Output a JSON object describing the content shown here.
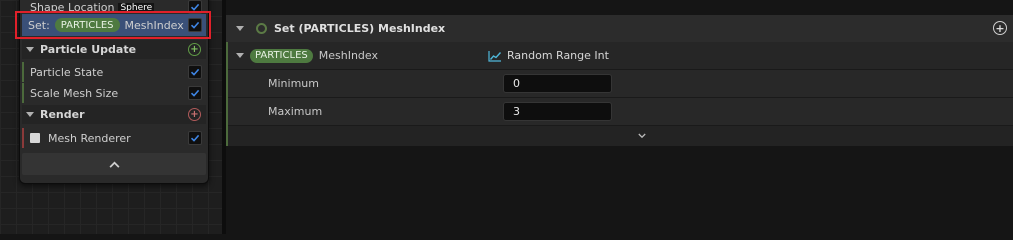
{
  "left_node": {
    "shape_location": {
      "label": "Shape Location",
      "value": "Sphere"
    },
    "set_row": {
      "prefix": "Set:",
      "pill": "PARTICLES",
      "label": "MeshIndex"
    },
    "particle_update": {
      "title": "Particle Update",
      "items": [
        "Particle State",
        "Scale Mesh Size"
      ]
    },
    "render": {
      "title": "Render",
      "items": [
        "Mesh Renderer"
      ]
    },
    "collapse_glyph": "^"
  },
  "panel": {
    "title": "Set (PARTICLES) MeshIndex",
    "add_glyph": "+",
    "param": {
      "pill": "PARTICLES",
      "name": "MeshIndex",
      "value_mode": "Random Range Int"
    },
    "minimum": {
      "label": "Minimum",
      "value": "0"
    },
    "maximum": {
      "label": "Maximum",
      "value": "3"
    },
    "expand_glyph": "⌄"
  },
  "colors": {
    "accent_green": "#4e7a40",
    "selection_red": "#e0202a",
    "selected_row_blue": "#3a5078"
  },
  "icons": [
    "checkmark-icon",
    "add-circle-icon",
    "remove-circle-icon",
    "cube-icon",
    "curve-icon",
    "chevron-up-icon",
    "chevron-down-icon"
  ]
}
